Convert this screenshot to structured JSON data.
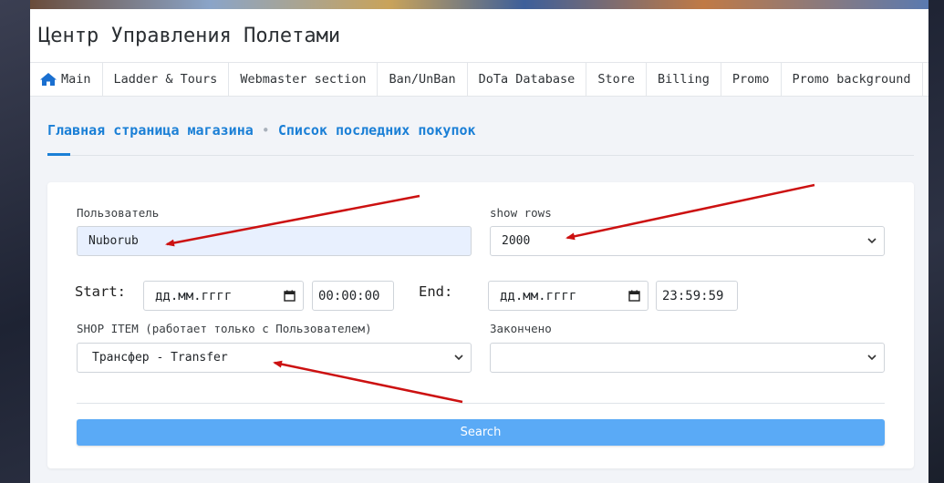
{
  "app": {
    "title": "Центр Управления Полетами"
  },
  "nav": {
    "items": [
      {
        "label": "Main",
        "icon": "home-icon"
      },
      {
        "label": "Ladder & Tours"
      },
      {
        "label": "Webmaster section"
      },
      {
        "label": "Ban/UnBan"
      },
      {
        "label": "DoTa Database"
      },
      {
        "label": "Store"
      },
      {
        "label": "Billing"
      },
      {
        "label": "Promo"
      },
      {
        "label": "Promo background"
      }
    ]
  },
  "tabs": {
    "main": "Главная страница магазина",
    "separator": "•",
    "recent": "Список последних покупок"
  },
  "form": {
    "user_label": "Пользователь",
    "user_value": "Nuborub",
    "rows_label": "show rows",
    "rows_value": "2000",
    "start_label": "Start:",
    "start_date": "дд.мм.гггг",
    "start_time": "00:00:00",
    "end_label": "End:",
    "end_date": "дд.мм.гггг",
    "end_time": "23:59:59",
    "shop_item_label": "SHOP ITEM (работает только с Пользователем)",
    "shop_item_value": "Трансфер - Transfer",
    "finished_label": "Закончено",
    "finished_value": "",
    "search_label": "Search"
  },
  "colors": {
    "accent": "#1a7fd6",
    "button": "#5aaaf6",
    "annotation_arrow": "#cc1111",
    "autofill_bg": "#e8f0fe"
  }
}
